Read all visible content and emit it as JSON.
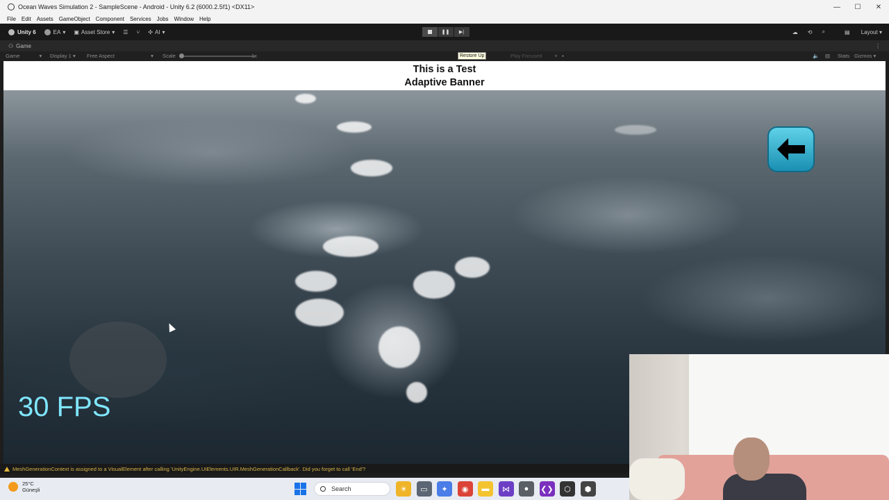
{
  "window": {
    "title": "Ocean Waves Simulation 2 - SampleScene - Android - Unity 6.2 (6000.2.5f1) <DX11>",
    "controls": [
      "—",
      "☐",
      "✕"
    ]
  },
  "menubar": {
    "items": [
      "File",
      "Edit",
      "Assets",
      "GameObject",
      "Component",
      "Services",
      "Jobs",
      "Window",
      "Help"
    ]
  },
  "toolbar": {
    "account": "Unity 6",
    "user": "EA",
    "asset_store": "Asset Store",
    "ai": "AI",
    "play_icons": [
      "stop-icon",
      "pause-icon",
      "step-icon"
    ],
    "layout": "Layout"
  },
  "tab": {
    "label": "Game"
  },
  "gamebar": {
    "mode": "Game",
    "display": "Display 1",
    "aspect": "Free Aspect",
    "scale_label": "Scale",
    "scale_value": "1x",
    "play_focused": "Play Focused",
    "stats": "Stats",
    "gizmos": "Gizmos",
    "tooltip": "Restore Up"
  },
  "game": {
    "banner_line1": "This is a Test",
    "banner_line2": "Adaptive Banner",
    "fps": "30 FPS",
    "back_button_icon": "arrow-left-icon"
  },
  "status": {
    "message": "MeshGenerationContext is assigned to a VisualElement after calling 'UnityEngine.UIElements.UIR.MeshGenerationCallback'. Did you forget to call 'End'?"
  },
  "taskbar": {
    "weather_temp": "25°C",
    "weather_desc": "Güneşli",
    "search_placeholder": "Search"
  },
  "colors": {
    "fps_text": "#7fe6ff",
    "back_button": "#2aa7cc",
    "warning": "#d8b54a"
  }
}
